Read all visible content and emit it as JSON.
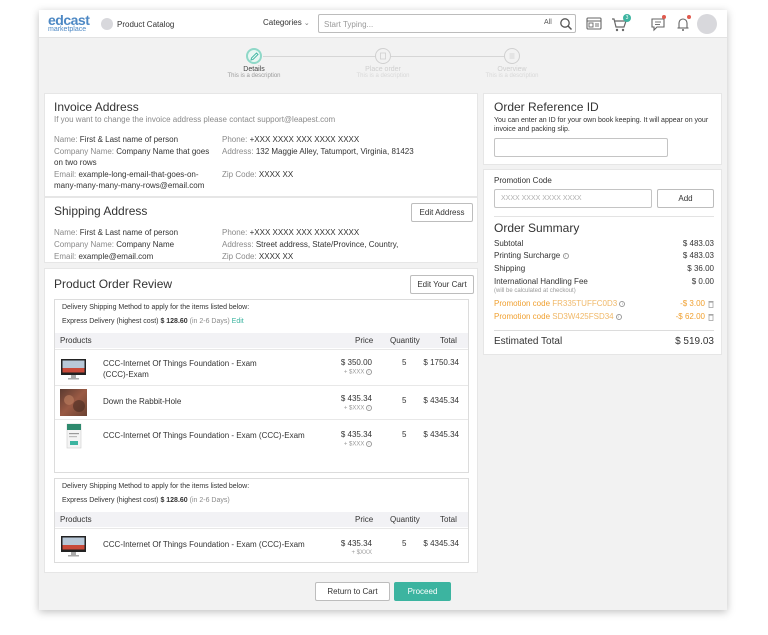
{
  "header": {
    "logo_main": "edcast",
    "logo_sub": "marketplace",
    "catalog_label": "Product Catalog",
    "categories_label": "Categories",
    "search_placeholder": "Start Typing...",
    "search_scope": "All",
    "cart_count": "3"
  },
  "steps": [
    {
      "title": "Details",
      "desc": "This is a description"
    },
    {
      "title": "Place order",
      "desc": "This is a description"
    },
    {
      "title": "Overview",
      "desc": "This is a description"
    }
  ],
  "invoice": {
    "title": "Invoice Address",
    "subtitle": "If you want to change the invoice address please contact support@leapest.com",
    "name_label": "Name:",
    "name_value": "First & Last name of person",
    "company_label": "Company Name:",
    "company_value": "Company Name that goes on two rows",
    "email_label": "Email:",
    "email_value": "example-long-email-that-goes-on-many-many-many-many-rows@email.com",
    "phone_label": "Phone:",
    "phone_value": "+XXX XXXX XXX XXXX XXXX",
    "address_label": "Address:",
    "address_value": "132 Maggie Alley, Tatumport, Virginia, 81423",
    "zip_label": "Zip Code:",
    "zip_value": "XXXX XX"
  },
  "shipping": {
    "title": "Shipping Address",
    "edit_label": "Edit Address",
    "name_label": "Name:",
    "name_value": "First & Last name of person",
    "company_label": "Company Name:",
    "company_value": "Company Name",
    "email_label": "Email:",
    "email_value": "example@email.com",
    "phone_label": "Phone:",
    "phone_value": "+XXX XXXX XXX XXXX XXXX",
    "address_label": "Address:",
    "address_value": "Street address, State/Province, Country,",
    "zip_label": "Zip Code:",
    "zip_value": "XXXX XX"
  },
  "review": {
    "title": "Product Order Review",
    "edit_cart_label": "Edit Your Cart",
    "columns": {
      "products": "Products",
      "price": "Price",
      "quantity": "Quantity",
      "total": "Total"
    },
    "groups": [
      {
        "method_label": "Delivery Shipping Method to apply for the items listed below:",
        "method_name": "Express Delivery (highest cost)",
        "method_price": "$ 128.60",
        "method_days": "(in 2-6 Days)",
        "edit_label": "Edit",
        "items": [
          {
            "name": "CCC-Internet Of Things Foundation - Exam (CCC)-Exam",
            "price": "$ 350.00",
            "tax": "+ $XXX",
            "qty": "5",
            "total": "$ 1750.34",
            "thumb": "monitor"
          },
          {
            "name": "Down the Rabbit-Hole",
            "price": "$ 435.34",
            "tax": "+ $XXX",
            "qty": "5",
            "total": "$ 4345.34",
            "thumb": "photo"
          },
          {
            "name": "CCC-Internet Of Things Foundation - Exam (CCC)-Exam",
            "price": "$ 435.34",
            "tax": "+ $XXX",
            "qty": "5",
            "total": "$ 4345.34",
            "thumb": "book"
          }
        ]
      },
      {
        "method_label": "Delivery Shipping Method to apply for the items listed below:",
        "method_name": "Express Delivery (highest cost)",
        "method_price": "$ 128.60",
        "method_days": "(in 2-6 Days)",
        "items": [
          {
            "name": "CCC-Internet Of Things Foundation - Exam (CCC)-Exam",
            "price": "$ 435.34",
            "tax": "+ $XXX",
            "qty": "5",
            "total": "$ 4345.34",
            "thumb": "monitor"
          }
        ]
      }
    ]
  },
  "order_ref": {
    "title": "Order Reference ID",
    "desc": "You can enter an ID for your own book keeping. It will appear on your invoice and packing slip."
  },
  "promo": {
    "label": "Promotion Code",
    "placeholder": "XXXX XXXX XXXX XXXX",
    "add_label": "Add"
  },
  "summary": {
    "title": "Order Summary",
    "subtotal_label": "Subtotal",
    "subtotal_value": "$ 483.03",
    "printing_label": "Printing Surcharge",
    "printing_value": "$ 483.03",
    "shipping_label": "Shipping",
    "shipping_value": "$ 36.00",
    "intl_label": "International Handling Fee",
    "intl_note": "(will be calculated at checkout)",
    "intl_value": "$ 0.00",
    "promos": [
      {
        "label": "Promotion code",
        "code": "FR335TUFFC0D3",
        "value": "-$ 3.00"
      },
      {
        "label": "Promotion code",
        "code": "SD3W425FSD34",
        "value": "-$ 62.00"
      }
    ],
    "estimated_label": "Estimated Total",
    "estimated_value": "$ 519.03"
  },
  "footer": {
    "return_label": "Return to Cart",
    "proceed_label": "Proceed"
  },
  "colors": {
    "accent": "#3cb4a0",
    "promo": "#f0a030",
    "brand": "#4d88c4"
  }
}
